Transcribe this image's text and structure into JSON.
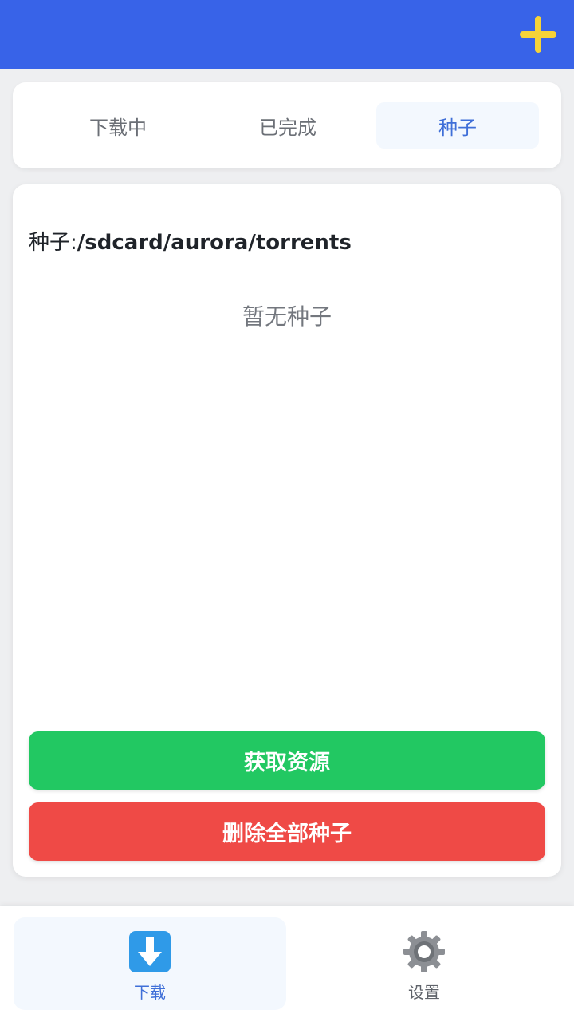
{
  "topbar": {
    "add_icon": "plus-icon",
    "accent_color": "#3863e8",
    "add_color": "#f6d338"
  },
  "tabs": [
    {
      "label": "下载中",
      "active": false
    },
    {
      "label": "已完成",
      "active": false
    },
    {
      "label": "种子",
      "active": true
    }
  ],
  "main": {
    "path_label": "种子:",
    "path_value": "/sdcard/aurora/torrents",
    "empty_text": "暂无种子",
    "fetch_button": "获取资源",
    "delete_button": "删除全部种子"
  },
  "bottom_nav": [
    {
      "label": "下载",
      "icon": "download-icon",
      "active": true
    },
    {
      "label": "设置",
      "icon": "gear-icon",
      "active": false
    }
  ]
}
